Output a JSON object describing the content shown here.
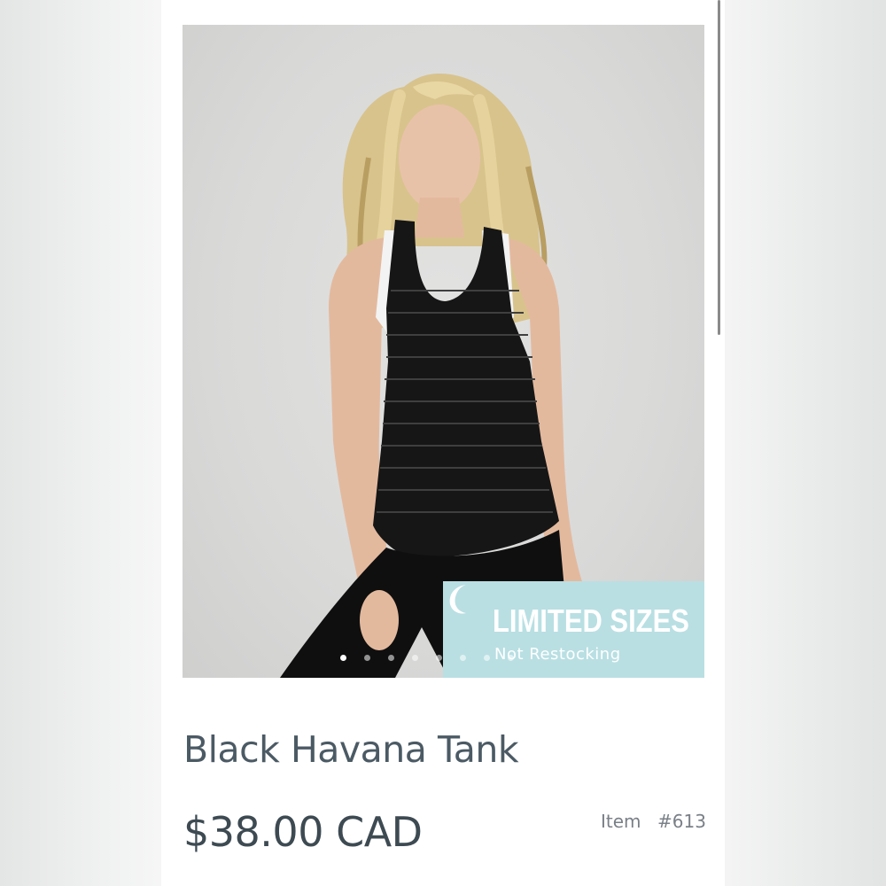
{
  "product": {
    "title": "Black Havana Tank",
    "price": "$38.00 CAD",
    "item_label": "Item",
    "item_number": "#613"
  },
  "badge": {
    "title": "LIMITED SIZES",
    "subtitle": "Not Restocking",
    "icon": "moon-icon",
    "color": "#b9dfe3"
  },
  "carousel": {
    "total": 8,
    "active_index": 0
  },
  "photo": {
    "description_icon": "product-photo"
  },
  "colors": {
    "text_title": "#4b5a64",
    "text_price": "#3d4a52",
    "text_muted": "#7a8088"
  }
}
